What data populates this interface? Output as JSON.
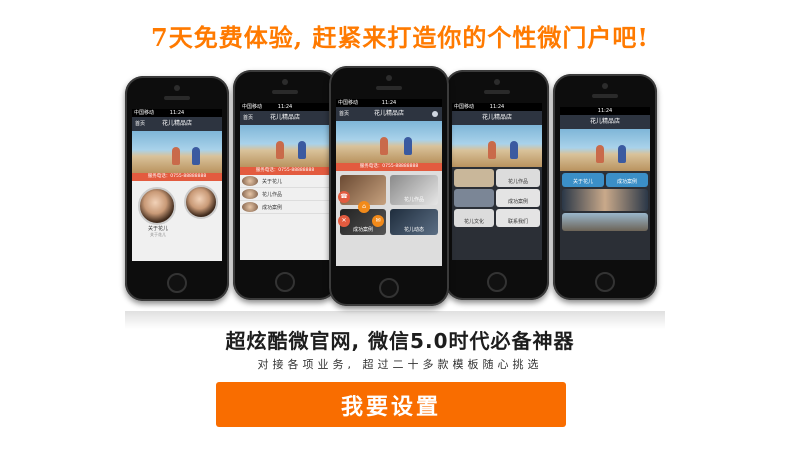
{
  "banner": {
    "headline": "7天免费体验, 赶紧来打造你的个性微门户吧!",
    "subtitle": "超炫酷微官网, 微信5.0时代必备神器",
    "description": "对接各项业务, 超过二十多款模板随心挑选",
    "cta_label": "我要设置",
    "accent_color": "#f96d00"
  },
  "phones": [
    {
      "status_time": "11:24",
      "carrier": "中国移动",
      "nav_home": "首页",
      "nav_title": "花儿精品店",
      "info_bar": "服务电话：0755-88888888",
      "items": [
        "关于花儿",
        "关于花儿"
      ]
    },
    {
      "status_time": "11:24",
      "carrier": "中国移动",
      "nav_home": "首页",
      "nav_title": "花儿精品店",
      "info_bar": "服务电话：0755-88888888",
      "items": [
        "关于花儿",
        "花儿作品",
        "成功案例"
      ]
    },
    {
      "status_time": "11:24",
      "carrier": "中国移动",
      "nav_home": "首页",
      "nav_title": "花儿精品店",
      "info_bar": "服务电话：0755-88888888",
      "items": [
        "花儿作品",
        "成功案例",
        "花儿动态"
      ]
    },
    {
      "status_time": "11:24",
      "carrier": "中国移动",
      "nav_home": "",
      "nav_title": "花儿精品店",
      "info_bar": "",
      "items": [
        "花儿作品",
        "成功案例",
        "花儿文化",
        "联系我们"
      ]
    },
    {
      "status_time": "11:24",
      "carrier": "",
      "nav_home": "",
      "nav_title": "花儿精品店",
      "info_bar": "",
      "items": [
        "关于花儿",
        "成功案例"
      ]
    }
  ]
}
